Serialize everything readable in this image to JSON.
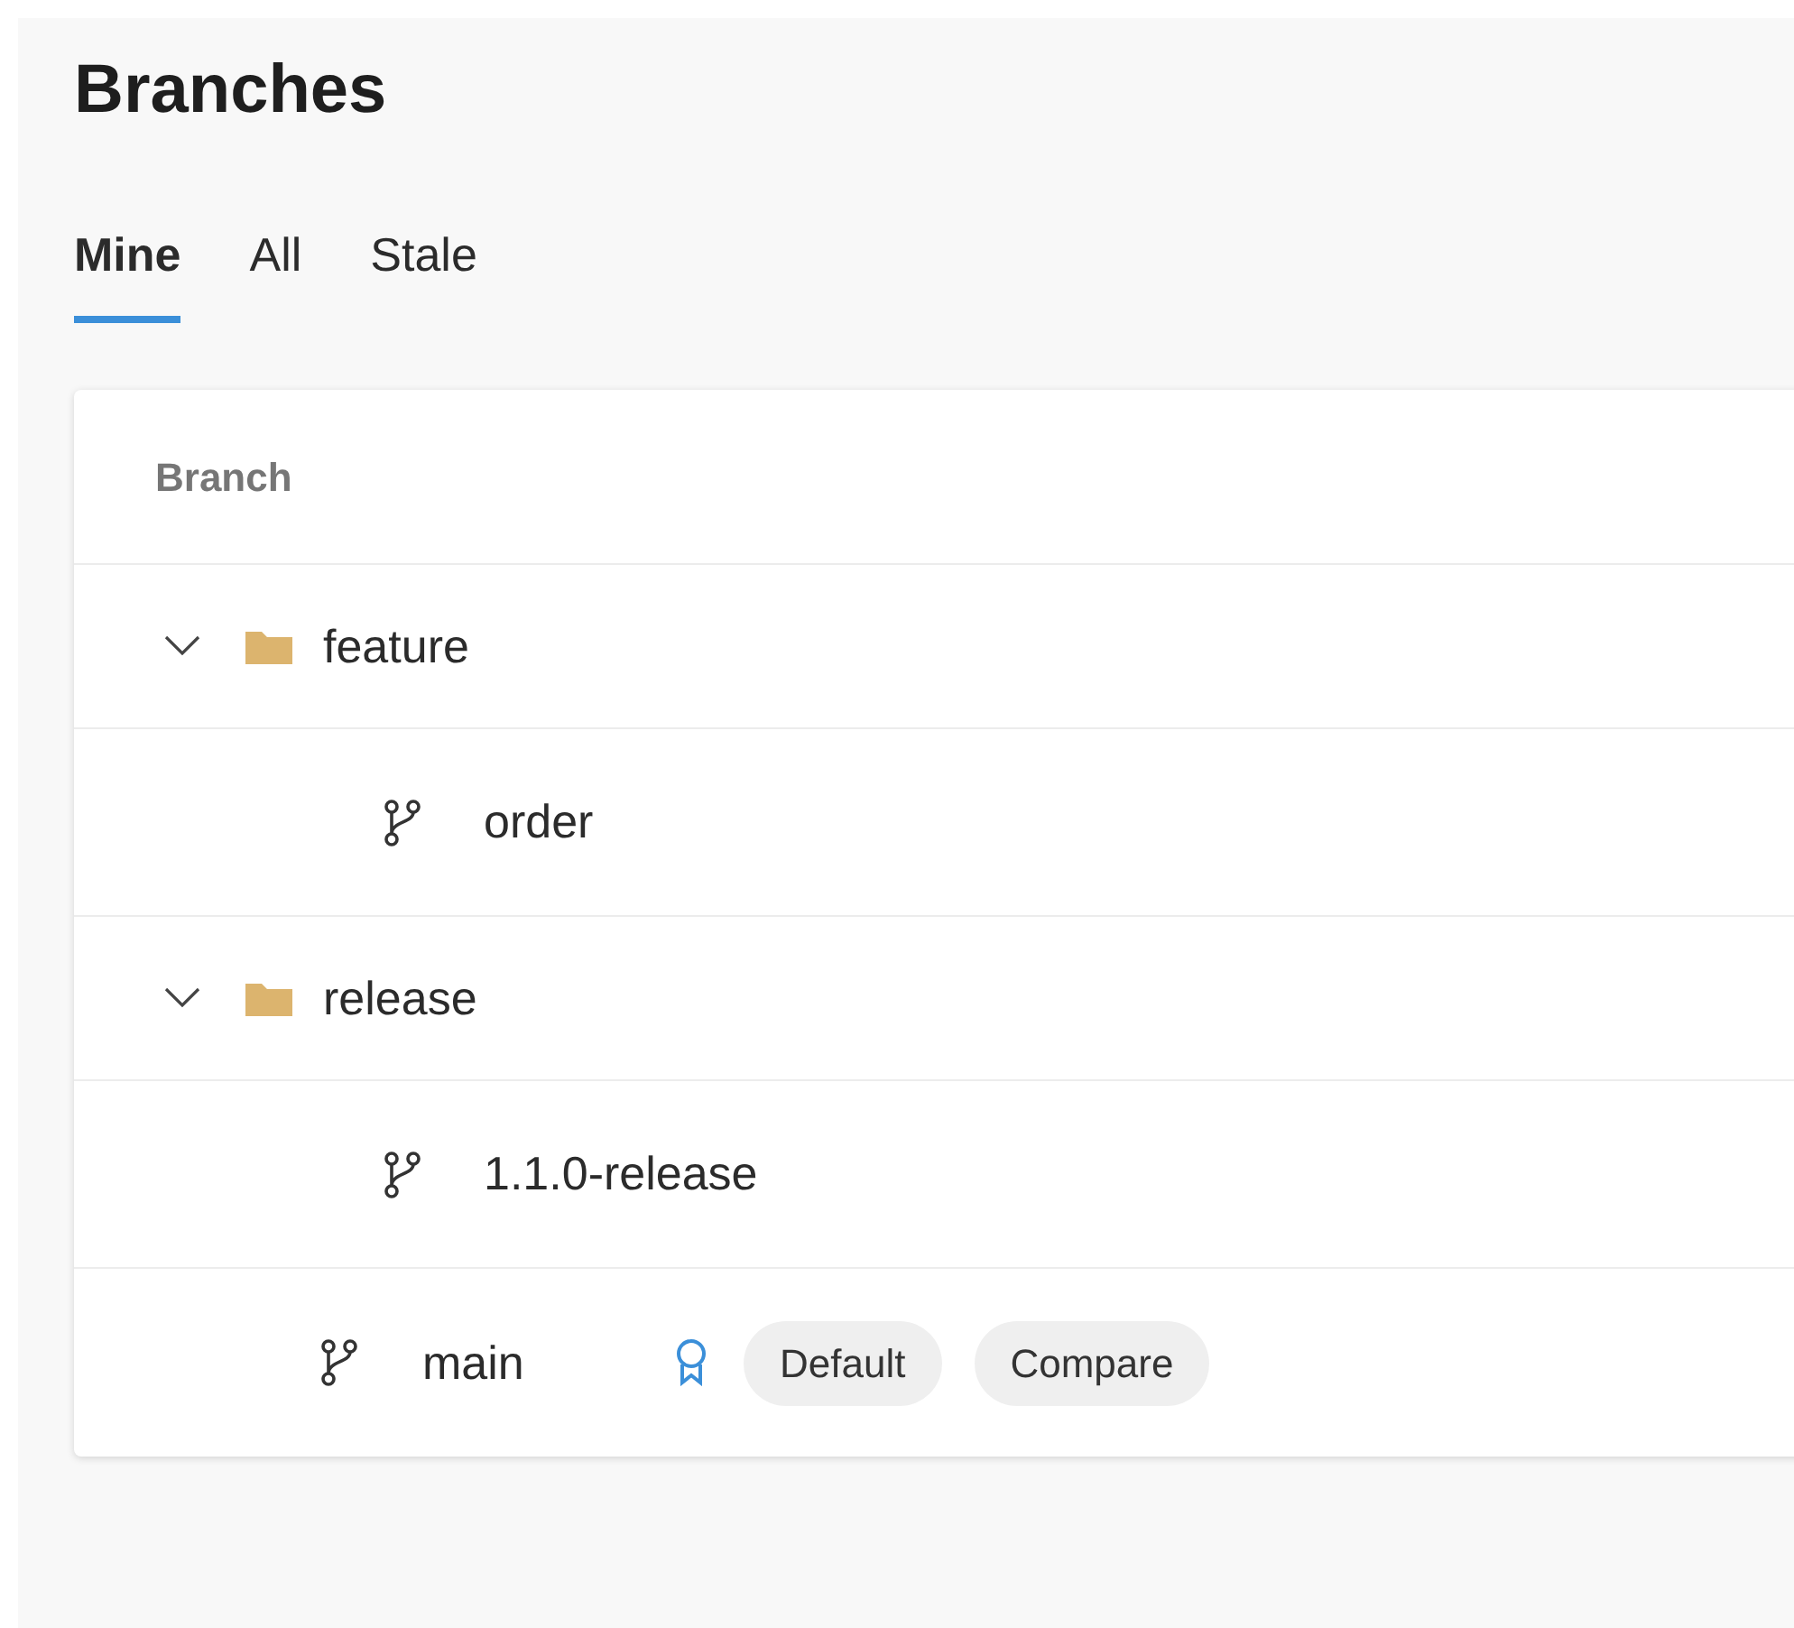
{
  "title": "Branches",
  "tabs": [
    {
      "label": "Mine",
      "selected": true
    },
    {
      "label": "All",
      "selected": false
    },
    {
      "label": "Stale",
      "selected": false
    }
  ],
  "table": {
    "columns": [
      "Branch"
    ],
    "rows": [
      {
        "kind": "folder",
        "name": "feature",
        "expanded": true,
        "children": [
          {
            "kind": "branch",
            "name": "order"
          }
        ]
      },
      {
        "kind": "folder",
        "name": "release",
        "expanded": true,
        "children": [
          {
            "kind": "branch",
            "name": "1.1.0-release"
          }
        ]
      },
      {
        "kind": "branch",
        "name": "main",
        "default_icon": true,
        "badges": [
          "Default",
          "Compare"
        ]
      }
    ]
  }
}
